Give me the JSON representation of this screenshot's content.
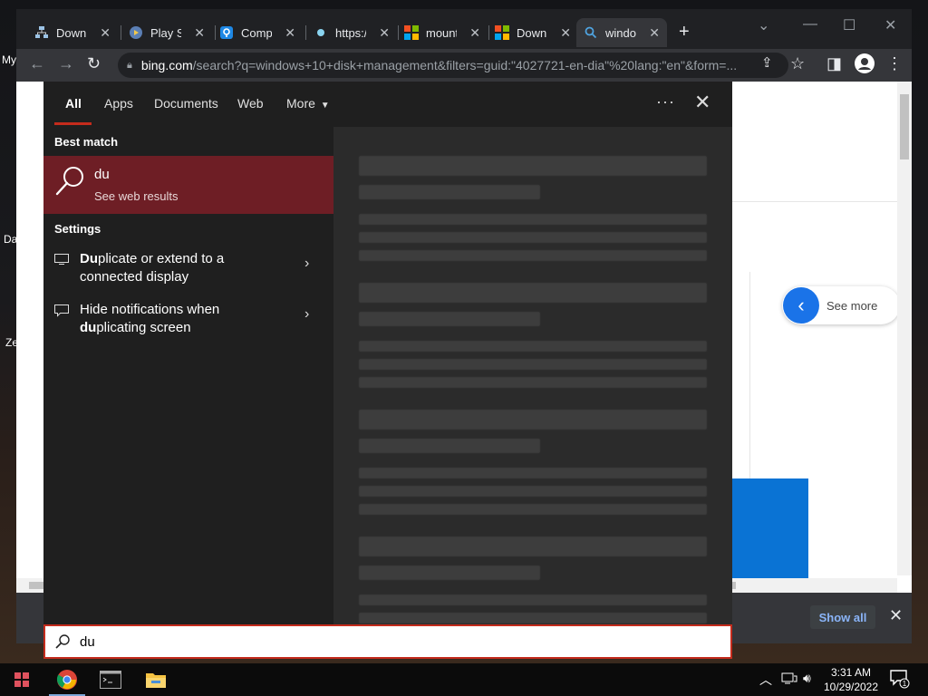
{
  "desktop": {
    "icon_labels": [
      "My",
      "Da",
      "Ze"
    ]
  },
  "browser": {
    "tabs": [
      {
        "title": "Downl",
        "favicon": "network-icon",
        "active": false
      },
      {
        "title": "Play Su",
        "favicon": "play-icon",
        "active": false
      },
      {
        "title": "Compr",
        "favicon": "location-pin-icon",
        "active": false
      },
      {
        "title": "https:/",
        "favicon": "dot-icon",
        "active": false
      },
      {
        "title": "mount",
        "favicon": "microsoft-logo-icon",
        "active": false
      },
      {
        "title": "Downl",
        "favicon": "microsoft-logo-icon",
        "active": false
      },
      {
        "title": "windov",
        "favicon": "search-icon",
        "active": true
      }
    ],
    "address": {
      "host": "bing.com",
      "rest": "/search?q=windows+10+disk+management&filters=guid:\"4027721-en-dia\"%20lang:\"en\"&form=..."
    },
    "page": {
      "see_more_label": "See more"
    },
    "download_bar": {
      "show_all_label": "Show all"
    }
  },
  "start_search": {
    "tabs": [
      "All",
      "Apps",
      "Documents",
      "Web",
      "More"
    ],
    "active_tab": "All",
    "best_match_heading": "Best match",
    "best_match": {
      "title": "du",
      "subtitle": "See web results"
    },
    "settings_heading": "Settings",
    "settings_items": [
      {
        "bold": "Du",
        "rest_line1": "plicate or extend to a",
        "line2": "connected display",
        "icon": "monitor-icon"
      },
      {
        "line1": "Hide notifications when",
        "bold": "du",
        "rest_line2": "plicating screen",
        "icon": "notification-icon"
      }
    ],
    "query": "du"
  },
  "taskbar": {
    "apps": [
      "chrome-icon",
      "terminal-icon",
      "file-explorer-icon"
    ],
    "time": "3:31 AM",
    "date": "10/29/2022",
    "notification_count": "1"
  },
  "colors": {
    "accent_red": "#c42b1c",
    "best_match_bg": "#6e1e25",
    "link_blue": "#8ab4f8"
  }
}
